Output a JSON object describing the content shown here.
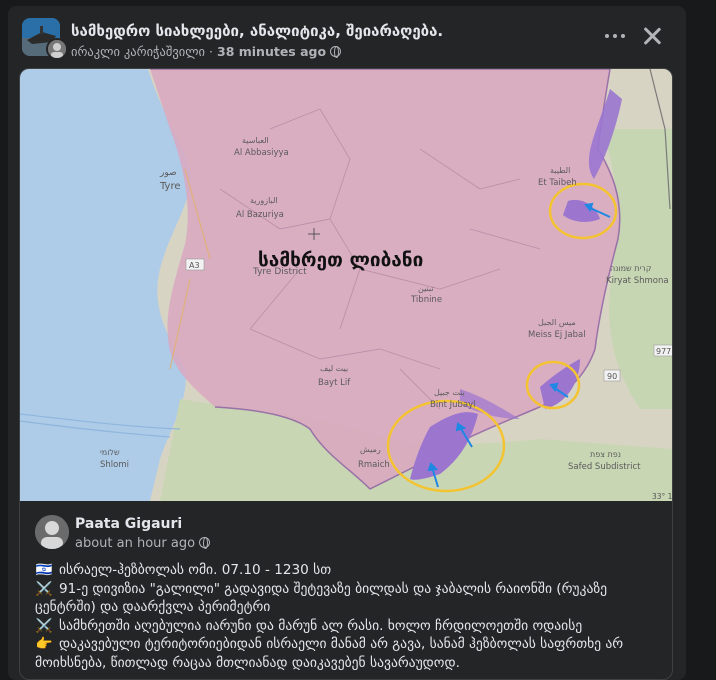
{
  "post": {
    "group_name": "სამხედრო სიახლეები, ანალიტიკა, შეიარაღება.",
    "author": "ირაკლი კარიჭაშვილი",
    "time": "38 minutes ago"
  },
  "map": {
    "main_label": "სამხრეთ ლიბანი",
    "labels": {
      "sour": "صور",
      "tyre": "Tyre",
      "al_abbasiyya_ar": "العباسية",
      "al_abbasiyya": "Al Abbasiyya",
      "al_bazuriya_ar": "البازورية",
      "al_bazuriya": "Al Bazuriya",
      "tyre_district": "Tyre District",
      "tibnine_ar": "تبنين",
      "tibnine": "Tibnine",
      "bayt_lif_ar": "بيت ليف",
      "bayt_lif": "Bayt Lif",
      "bint_jubayl_ar": "بنت جبيل",
      "bint_jubayl": "Bint Jubayl",
      "rmaich_ar": "رميش",
      "rmaich": "Rmaich",
      "et_taibeh_ar": "الطيبة",
      "et_taibeh": "Et Taibeh",
      "kiryat_he": "קרית שמונה",
      "kiryat": "Kiryat Shmona",
      "meiss_ar": "ميس الجبل",
      "meiss": "Meiss Ej Jabal",
      "shlomi_he": "שלומי",
      "shlomi": "Shlomi",
      "safed_he": "נפת צפת",
      "safed": "Safed Subdistrict",
      "road_a3": "A3",
      "road_977": "977",
      "road_90": "90",
      "coord": "33° 1"
    }
  },
  "shared_post": {
    "author": "Paata Gigauri",
    "time": "about an hour ago",
    "lines": [
      {
        "emoji": "🇮🇱",
        "text": "ისრაელ-ჰეზბოლას ომი. 07.10 - 1230 სთ"
      },
      {
        "emoji": "⚔️",
        "text": "91-ე დივიზია \"გალილი\" გადავიდა შეტევაზე ბილდას და ჯაბალის რაიონში (რუკაზე ცენტრში) და დაარქვლა პერიმეტრი"
      },
      {
        "emoji": "⚔️",
        "text": "სამხრეთში აღებულია იარუნი და მარუნ ალ რასი. ხოლო ჩრდილოეთში ოდაისე"
      },
      {
        "emoji": "👉",
        "text": "დაკავებული ტერიტორიებიდან ისრაელი მანამ არ გავა, სანამ ჰეზბოლას საფრთხე არ მოიხსნება, წითლად რაცაა მთლიანად დაიკავებენ სავარაუდოდ."
      }
    ]
  }
}
